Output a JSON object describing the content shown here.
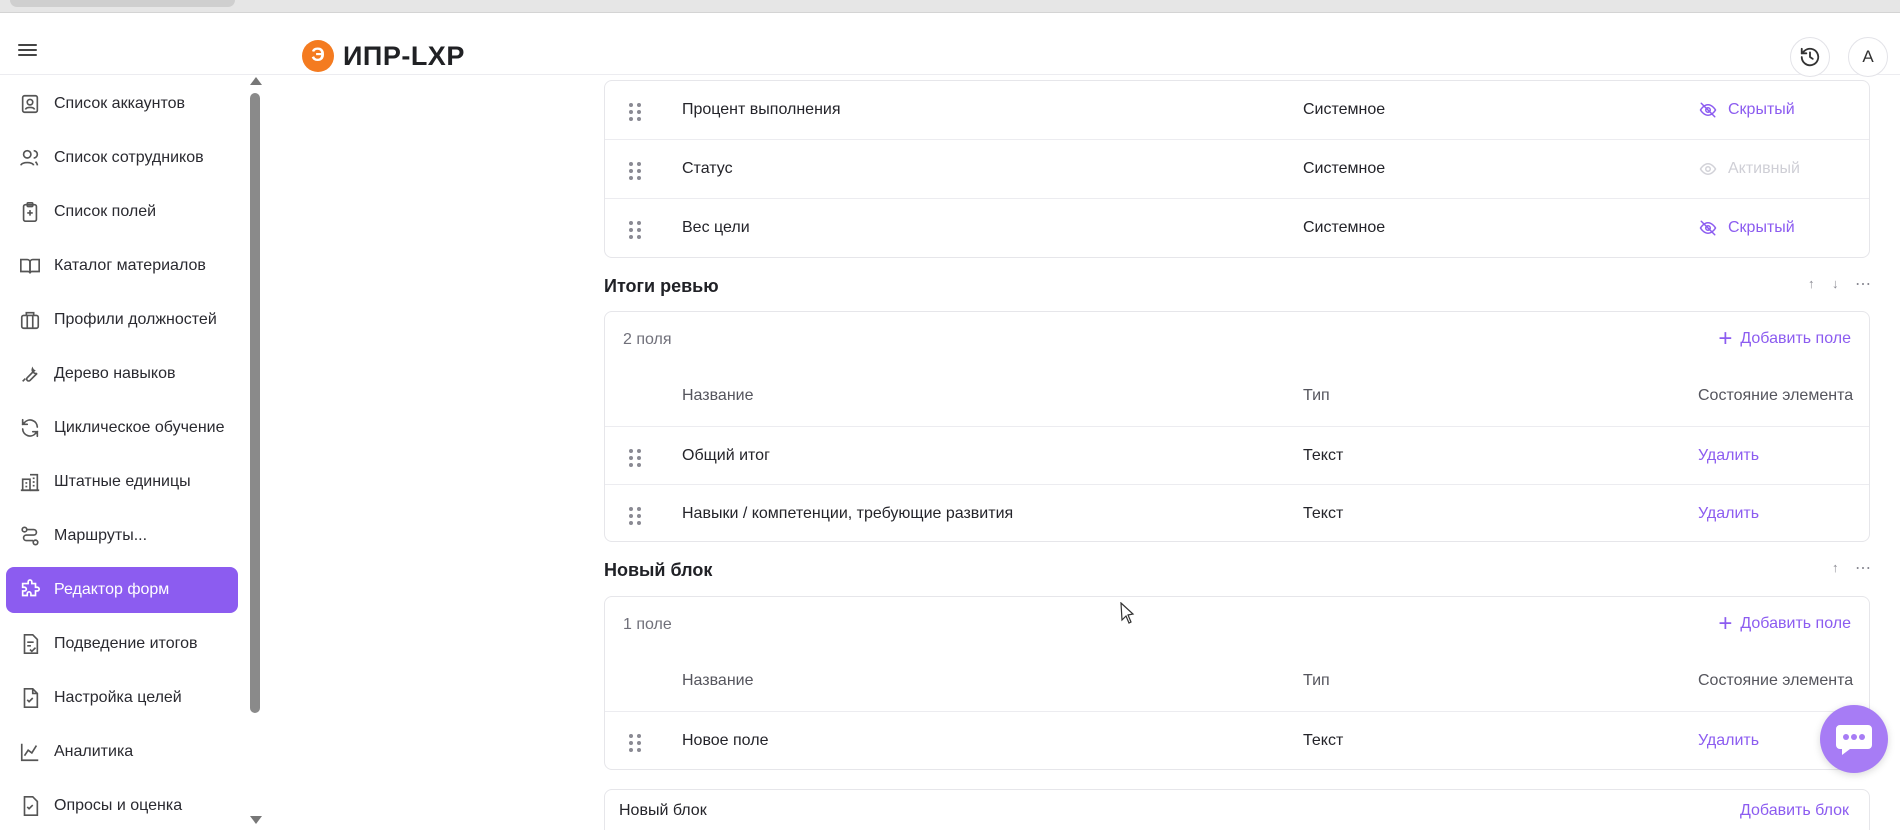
{
  "app": {
    "logo_letter": "Э",
    "logo_text": "ИПР-LXP",
    "logo_color": "#f47b20",
    "accent": "#8c5cf0"
  },
  "header": {
    "history_icon": "history-icon",
    "avatar_letter": "A"
  },
  "sidebar": {
    "items": [
      {
        "label": "Список аккаунтов",
        "icon": "account-card-icon"
      },
      {
        "label": "Список сотрудников",
        "icon": "users-icon"
      },
      {
        "label": "Список полей",
        "icon": "clipboard-plus-icon"
      },
      {
        "label": "Каталог материалов",
        "icon": "book-icon"
      },
      {
        "label": "Профили должностей",
        "icon": "briefcase-icon"
      },
      {
        "label": "Дерево навыков",
        "icon": "wrench-icon"
      },
      {
        "label": "Циклическое обучение",
        "icon": "refresh-icon"
      },
      {
        "label": "Штатные единицы",
        "icon": "building-icon"
      },
      {
        "label": "Маршруты...",
        "icon": "route-icon"
      },
      {
        "label": "Редактор форм",
        "icon": "puzzle-icon",
        "active": true
      },
      {
        "label": "Подведение итогов",
        "icon": "document-check-icon"
      },
      {
        "label": "Настройка целей",
        "icon": "file-check-icon"
      },
      {
        "label": "Аналитика",
        "icon": "chart-line-icon"
      },
      {
        "label": "Опросы и оценка",
        "icon": "survey-icon"
      }
    ]
  },
  "goals_block": {
    "rows": [
      {
        "name": "Процент выполнения",
        "type": "Системное",
        "state": "Скрытый",
        "state_active": false
      },
      {
        "name": "Статус",
        "type": "Системное",
        "state": "Активный",
        "state_active": true
      },
      {
        "name": "Вес цели",
        "type": "Системное",
        "state": "Скрытый",
        "state_active": false
      }
    ]
  },
  "review_block": {
    "title": "Итоги ревью",
    "count": "2 поля",
    "add_field": "Добавить поле",
    "columns": {
      "name": "Название",
      "type": "Тип",
      "state": "Состояние элемента"
    },
    "rows": [
      {
        "name": "Общий итог",
        "type": "Текст",
        "action": "Удалить"
      },
      {
        "name": "Навыки / компетенции, требующие развития",
        "type": "Текст",
        "action": "Удалить"
      }
    ]
  },
  "new_block": {
    "title": "Новый блок",
    "count": "1 поле",
    "add_field": "Добавить поле",
    "columns": {
      "name": "Название",
      "type": "Тип",
      "state": "Состояние элемента"
    },
    "rows": [
      {
        "name": "Новое поле",
        "type": "Текст",
        "action": "Удалить"
      }
    ]
  },
  "footer": {
    "label": "Новый блок",
    "add_block": "Добавить блок"
  }
}
